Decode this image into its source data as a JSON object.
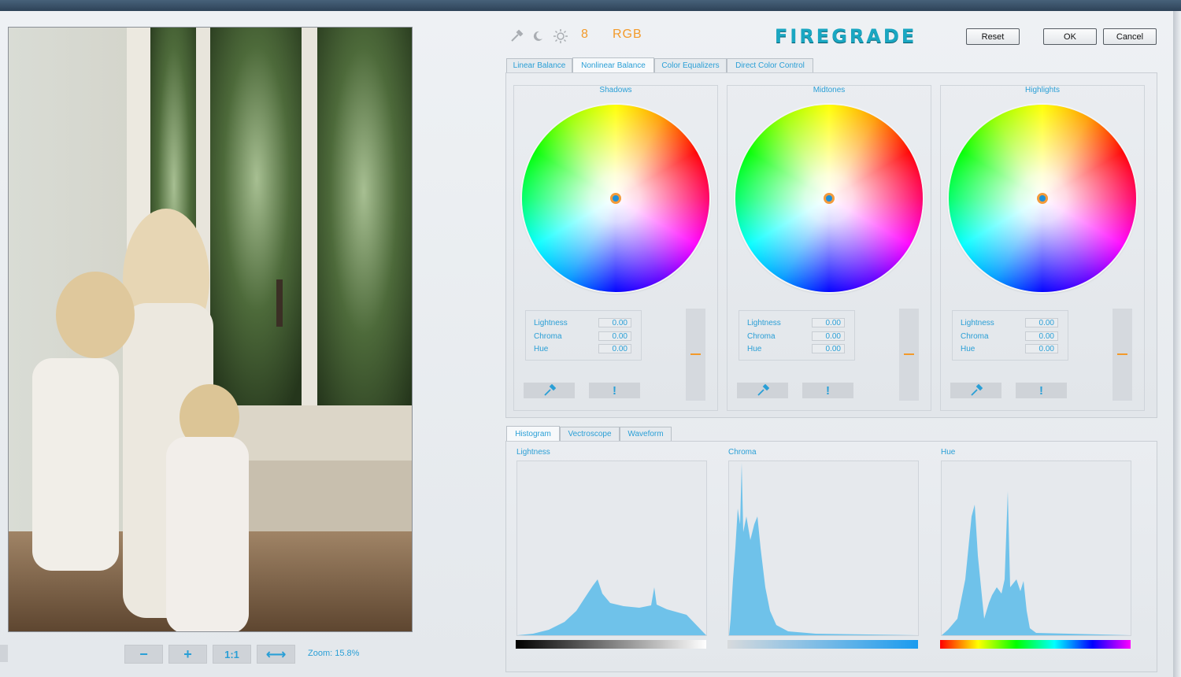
{
  "toolbar": {
    "icons": [
      "eyedropper-icon",
      "moon-icon",
      "sun-icon"
    ],
    "bit_depth": "8",
    "color_mode": "RGB",
    "logo": "FIREGRADE",
    "reset_label": "Reset",
    "ok_label": "OK",
    "cancel_label": "Cancel"
  },
  "tabs": [
    {
      "label": "Linear Balance",
      "active": false
    },
    {
      "label": "Nonlinear Balance",
      "active": true
    },
    {
      "label": "Color Equalizers",
      "active": false
    },
    {
      "label": "Direct Color Control",
      "active": false
    }
  ],
  "sections": [
    {
      "title": "Shadows",
      "lightness_label": "Lightness",
      "lightness": "0.00",
      "chroma_label": "Chroma",
      "chroma": "0.00",
      "hue_label": "Hue",
      "hue": "0.00",
      "picker_icon": "eyedropper-icon",
      "reset_glyph": "!"
    },
    {
      "title": "Midtones",
      "lightness_label": "Lightness",
      "lightness": "0.00",
      "chroma_label": "Chroma",
      "chroma": "0.00",
      "hue_label": "Hue",
      "hue": "0.00",
      "picker_icon": "eyedropper-icon",
      "reset_glyph": "!"
    },
    {
      "title": "Highlights",
      "lightness_label": "Lightness",
      "lightness": "0.00",
      "chroma_label": "Chroma",
      "chroma": "0.00",
      "hue_label": "Hue",
      "hue": "0.00",
      "picker_icon": "eyedropper-icon",
      "reset_glyph": "!"
    }
  ],
  "analysis_tabs": [
    {
      "label": "Histogram",
      "active": true
    },
    {
      "label": "Vectroscope",
      "active": false
    },
    {
      "label": "Waveform",
      "active": false
    }
  ],
  "histograms": [
    {
      "label": "Lightness"
    },
    {
      "label": "Chroma"
    },
    {
      "label": "Hue"
    }
  ],
  "zoom": {
    "buttons": [
      {
        "glyph": "−",
        "icon": "zoom-out-icon"
      },
      {
        "glyph": "+",
        "icon": "zoom-in-icon"
      },
      {
        "glyph": "1:1",
        "icon": "actual-size-icon"
      },
      {
        "glyph": "⟷",
        "icon": "fit-width-icon"
      }
    ],
    "label": "Zoom: 15.8%"
  },
  "colors": {
    "accent": "#2a9fd6",
    "orange": "#f39a2a",
    "histogram_fill": "#6fc2ea"
  }
}
